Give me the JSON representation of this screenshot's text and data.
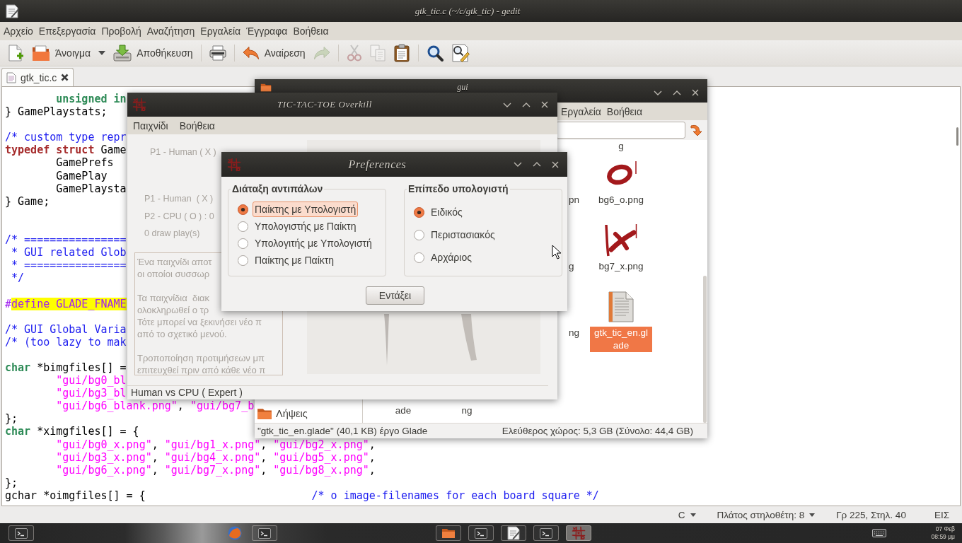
{
  "editor": {
    "title": "gtk_tic.c (~/c/gtk_tic) - gedit",
    "menu": [
      "Αρχείο",
      "Επεξεργασία",
      "Προβολή",
      "Αναζήτηση",
      "Εργαλεία",
      "Έγγραφα",
      "Βοήθεια"
    ],
    "toolbar": [
      [
        {
          "kind": "new",
          "disabled": false
        },
        {
          "kind": "open",
          "label": "Άνοιγμα",
          "disabled": false
        },
        {
          "kind": "menu-arrow",
          "disabled": false
        },
        {
          "kind": "save",
          "label": "Αποθήκευση",
          "disabled": false
        }
      ],
      [
        {
          "kind": "print",
          "disabled": false
        }
      ],
      [
        {
          "kind": "undo",
          "label": "Αναίρεση",
          "disabled": false
        },
        {
          "kind": "redo",
          "disabled": true
        }
      ],
      [
        {
          "kind": "cut",
          "disabled": true
        },
        {
          "kind": "copy",
          "disabled": true
        },
        {
          "kind": "paste",
          "disabled": false
        }
      ],
      [
        {
          "kind": "find",
          "disabled": false
        },
        {
          "kind": "replace",
          "disabled": false
        }
      ]
    ],
    "tabs": [
      {
        "label": "gtk_tic.c",
        "selected": true
      }
    ],
    "code_lines": [
      {
        "kind": "code",
        "segments": [
          {
            "kind": "type",
            "text": "        unsigned in"
          }
        ]
      },
      {
        "kind": "code",
        "segments": [
          {
            "kind": "plain",
            "text": "} GamePlaystats;"
          }
        ]
      },
      {
        "kind": "blank"
      },
      {
        "kind": "code",
        "segments": [
          {
            "kind": "comment",
            "text": "/* custom type repr"
          }
        ]
      },
      {
        "kind": "code",
        "segments": [
          {
            "kind": "keyword",
            "text": "typedef struct"
          },
          {
            "kind": "plain",
            "text": " Game"
          }
        ]
      },
      {
        "kind": "code",
        "segments": [
          {
            "kind": "plain",
            "text": "        GamePrefs"
          }
        ]
      },
      {
        "kind": "code",
        "segments": [
          {
            "kind": "plain",
            "text": "        GamePlay"
          }
        ]
      },
      {
        "kind": "code",
        "segments": [
          {
            "kind": "plain",
            "text": "        GamePlaysta"
          }
        ]
      },
      {
        "kind": "code",
        "segments": [
          {
            "kind": "plain",
            "text": "} Game;"
          }
        ]
      },
      {
        "kind": "blank"
      },
      {
        "kind": "blank"
      },
      {
        "kind": "code",
        "segments": [
          {
            "kind": "comment",
            "text": "/* ================"
          }
        ]
      },
      {
        "kind": "code",
        "segments": [
          {
            "kind": "comment",
            "text": " * GUI related Glob"
          }
        ]
      },
      {
        "kind": "code",
        "segments": [
          {
            "kind": "comment",
            "text": " * ================"
          }
        ]
      },
      {
        "kind": "code",
        "segments": [
          {
            "kind": "comment",
            "text": " */"
          }
        ]
      },
      {
        "kind": "blank"
      },
      {
        "kind": "code",
        "segments": [
          {
            "kind": "preproc",
            "text": "#"
          },
          {
            "kind": "match",
            "text": "define GLADE_FNAME"
          }
        ]
      },
      {
        "kind": "blank"
      },
      {
        "kind": "code",
        "segments": [
          {
            "kind": "comment",
            "text": "/* GUI Global Varia"
          }
        ]
      },
      {
        "kind": "code",
        "segments": [
          {
            "kind": "comment",
            "text": "/* (too lazy to mak"
          }
        ]
      },
      {
        "kind": "blank"
      },
      {
        "kind": "code",
        "segments": [
          {
            "kind": "type",
            "text": "char"
          },
          {
            "kind": "plain",
            "text": " *bimgfiles[] ="
          }
        ]
      },
      {
        "kind": "code",
        "segments": [
          {
            "kind": "string",
            "text": "        \"gui/bg0_bl"
          }
        ]
      },
      {
        "kind": "code",
        "segments": [
          {
            "kind": "string",
            "text": "        \"gui/bg3_bl"
          }
        ]
      },
      {
        "kind": "code",
        "segments": [
          {
            "kind": "string",
            "text": "        \"gui/bg6_blank.png\""
          },
          {
            "kind": "plain",
            "text": ", "
          },
          {
            "kind": "string",
            "text": "\"gui/bg7_b"
          }
        ]
      },
      {
        "kind": "code",
        "segments": [
          {
            "kind": "plain",
            "text": "};"
          }
        ]
      },
      {
        "kind": "code",
        "segments": [
          {
            "kind": "type",
            "text": "char"
          },
          {
            "kind": "plain",
            "text": " *ximgfiles[] = {"
          }
        ]
      },
      {
        "kind": "code",
        "segments": [
          {
            "kind": "string",
            "text": "        \"gui/bg0_x.png\""
          },
          {
            "kind": "plain",
            "text": ", "
          },
          {
            "kind": "string",
            "text": "\"gui/bg1_x.png\""
          },
          {
            "kind": "plain",
            "text": ", "
          },
          {
            "kind": "string",
            "text": "\"gui/bg2_x.png\""
          },
          {
            "kind": "plain",
            "text": ","
          }
        ]
      },
      {
        "kind": "code",
        "segments": [
          {
            "kind": "string",
            "text": "        \"gui/bg3_x.png\""
          },
          {
            "kind": "plain",
            "text": ", "
          },
          {
            "kind": "string",
            "text": "\"gui/bg4_x.png\""
          },
          {
            "kind": "plain",
            "text": ", "
          },
          {
            "kind": "string",
            "text": "\"gui/bg5_x.png\""
          },
          {
            "kind": "plain",
            "text": ","
          }
        ]
      },
      {
        "kind": "code",
        "segments": [
          {
            "kind": "string",
            "text": "        \"gui/bg6_x.png\""
          },
          {
            "kind": "plain",
            "text": ", "
          },
          {
            "kind": "string",
            "text": "\"gui/bg7_x.png\""
          },
          {
            "kind": "plain",
            "text": ", "
          },
          {
            "kind": "string",
            "text": "\"gui/bg8_x.png\""
          },
          {
            "kind": "plain",
            "text": ","
          }
        ]
      },
      {
        "kind": "code",
        "segments": [
          {
            "kind": "plain",
            "text": "};"
          }
        ]
      },
      {
        "kind": "code",
        "segments": [
          {
            "kind": "plain",
            "text": "gchar *oimgfiles[] = {                          "
          },
          {
            "kind": "comment",
            "text": "/* o image-filenames for each board square */"
          }
        ]
      }
    ],
    "status_bar": [
      {
        "kind": "menu",
        "label": "C"
      },
      {
        "kind": "menu",
        "label": "Πλάτος στηλοθέτη: 8"
      },
      {
        "kind": "text",
        "label": "Γρ 225, Στηλ. 40"
      },
      {
        "kind": "text",
        "label": "ΕΙΣ"
      }
    ]
  },
  "file_manager": {
    "title": "gui",
    "menu": [
      "Εργαλεία",
      "Βοήθεια"
    ],
    "sidebar": [
      "Λήψεις"
    ],
    "column_3_labels": [
      "pn",
      "g",
      "ng"
    ],
    "column_4_items": [
      {
        "kind": "label-only",
        "label": "g",
        "selected": false
      },
      {
        "kind": "o-image",
        "label": "bg6_o.png",
        "selected": false
      },
      {
        "kind": "x-image",
        "label": "bg7_x.png",
        "selected": false
      },
      {
        "kind": "document",
        "label": "gtk_tic_en.glade",
        "selected": true
      }
    ],
    "bottom_row_labels": [
      "ade",
      "ng"
    ],
    "status_left": "\"gtk_tic_en.glade\" (40,1 KB) έργο Glade",
    "status_right": "Ελεύθερος χώρος: 5,3 GB (Σύνολο: 44,4 GB)"
  },
  "game_window": {
    "title": "TIC-TAC-TOE Overkill",
    "menu": [
      "Παιχνίδι",
      "Βοήθεια"
    ],
    "insensitive": true,
    "player_label": "P1 - Human ( X )",
    "stats": [
      "P1 - Human  ( X )",
      "P2 - CPU ( O ) : 0",
      "0 draw play(s)"
    ],
    "info_paragraphs": [
      [
        "Ένα παιχνίδι αποτ",
        "οι οποίοι συσσωρ"
      ],
      [
        "Τα παιχνίδια  διακ",
        "ολοκληρωθεί ο τρ",
        "Τότε μπορεί να ξεκινήσει νέο π",
        "από το σχετικό μενού."
      ],
      [
        "Τροποποίηση προτιμήσεων μπ",
        "επιτευχθεί πριν από κάθε νέο π"
      ]
    ],
    "status": "Human vs CPU ( Expert )"
  },
  "preferences": {
    "title": "Preferences",
    "groups": [
      {
        "label": "Διάταξη αντιπάλων",
        "options": [
          {
            "label": "Παίκτης με Υπολογιστή",
            "selected": true,
            "focused": true
          },
          {
            "label": "Υπολογιστής με Παίκτη",
            "selected": false,
            "focused": false
          },
          {
            "label": "Υπολογιτής με Υπολογιστή",
            "selected": false,
            "focused": false
          },
          {
            "label": "Παίκτης με Παίκτη",
            "selected": false,
            "focused": false
          }
        ]
      },
      {
        "label": "Επίπεδο υπολογιστή",
        "options": [
          {
            "label": "Ειδικός",
            "selected": true,
            "focused": false
          },
          {
            "label": "Περιστασιακός",
            "selected": false,
            "focused": false
          },
          {
            "label": "Αρχάριος",
            "selected": false,
            "focused": false
          }
        ]
      }
    ],
    "button": "Εντάξει"
  },
  "taskbar": {
    "groups": [
      [
        {
          "kind": "terminal",
          "active": false
        }
      ],
      [
        {
          "kind": "browser",
          "active": false
        },
        {
          "kind": "terminal",
          "active": false
        }
      ],
      [
        {
          "kind": "folder",
          "active": false
        },
        {
          "kind": "terminal",
          "active": false
        },
        {
          "kind": "editor",
          "active": false
        },
        {
          "kind": "terminal",
          "active": false
        },
        {
          "kind": "game",
          "active": true
        }
      ]
    ],
    "clock": {
      "date": "07 Φεβ",
      "time": "08:59 μμ"
    }
  }
}
